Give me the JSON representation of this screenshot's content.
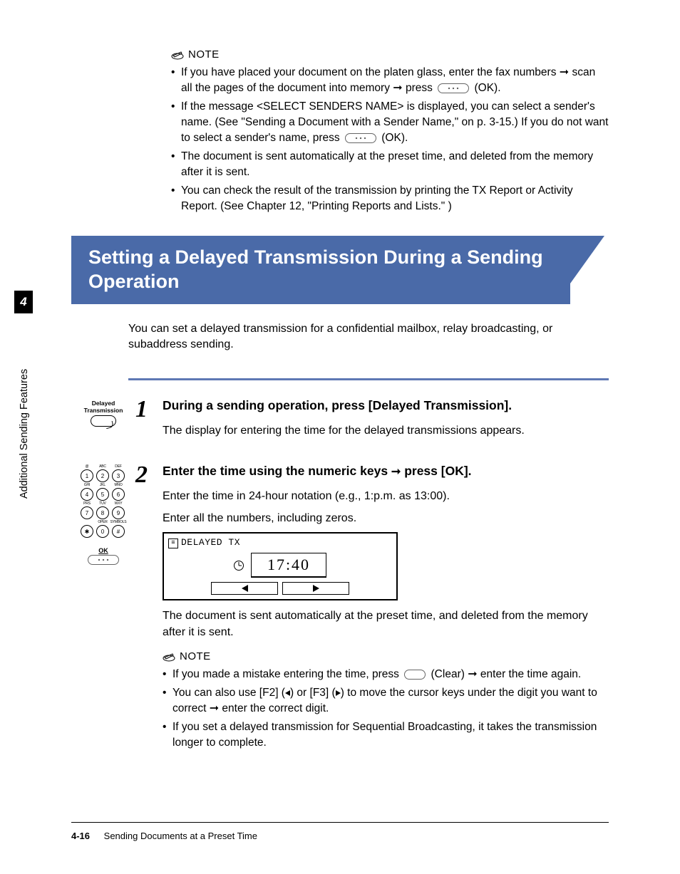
{
  "note1": {
    "label": "NOTE",
    "items": [
      {
        "prefix": "If you have placed your document on the platen glass, enter the fax numbers ",
        "mid": " scan all the pages of the document into memory ",
        "press": " press ",
        "suffix": " (OK)."
      },
      {
        "line1": "If the message <SELECT SENDERS NAME> is displayed, you can select a sender's name. (See \"Sending a Document with a Sender Name,\" on p. 3-15.) If you do not want to select a sender's name, press ",
        "suffix": " (OK)."
      },
      {
        "text": "The document is sent automatically at the preset time, and deleted from the memory after it is sent."
      },
      {
        "text": "You can check the result of the transmission by printing the TX Report or Activity Report. (See Chapter 12, \"Printing Reports and Lists.\" )"
      }
    ]
  },
  "banner": "Setting a Delayed Transmission During a Sending Operation",
  "intro": "You can set a delayed transmission for a confidential mailbox, relay broadcasting, or subaddress sending.",
  "sideTab": "4",
  "sideCaption": "Additional Sending Features",
  "step1": {
    "num": "1",
    "btnLabel1": "Delayed",
    "btnLabel2": "Transmission",
    "heading": "During a sending operation, press [Delayed Transmission].",
    "body": "The display for entering the time for the delayed transmissions appears."
  },
  "step2": {
    "num": "2",
    "heading_a": "Enter the time using the numeric keys ",
    "heading_b": " press [OK].",
    "body1": "Enter the time in 24-hour notation (e.g., 1:p.m. as 13:00).",
    "body2": "Enter all the numbers, including zeros.",
    "lcdTitle": "DELAYED TX",
    "lcdTime": "17:40",
    "body3": "The document is sent automatically at the preset time, and deleted from the memory after it is sent."
  },
  "keys": {
    "r1": [
      {
        "n": "1",
        "l": "@"
      },
      {
        "n": "2",
        "l": "ABC"
      },
      {
        "n": "3",
        "l": "DEF"
      }
    ],
    "r2": [
      {
        "n": "4",
        "l": "GHI"
      },
      {
        "n": "5",
        "l": "JKL"
      },
      {
        "n": "6",
        "l": "MNO"
      }
    ],
    "r3": [
      {
        "n": "7",
        "l": "PRS"
      },
      {
        "n": "8",
        "l": "TUV"
      },
      {
        "n": "9",
        "l": "WXY"
      }
    ],
    "r4": [
      {
        "n": "✱",
        "l": ""
      },
      {
        "n": "0",
        "l": "OPER"
      },
      {
        "n": "#",
        "l": "SYMBOLS"
      }
    ],
    "ok": "OK"
  },
  "note2": {
    "label": "NOTE",
    "items": [
      {
        "prefix": "If you made a mistake entering the time, press ",
        "mid": " (Clear) ",
        "suffix": " enter the time again."
      },
      {
        "prefix": "You can also use [F2] (",
        "mid": ") or [F3] (",
        "mid2": ") to move the cursor keys under the digit you want to correct ",
        "suffix": " enter the correct digit."
      },
      {
        "text": "If you set a delayed transmission for Sequential Broadcasting, it takes the transmission longer to complete."
      }
    ]
  },
  "footer": {
    "page": "4-16",
    "title": "Sending Documents at a Preset Time"
  }
}
